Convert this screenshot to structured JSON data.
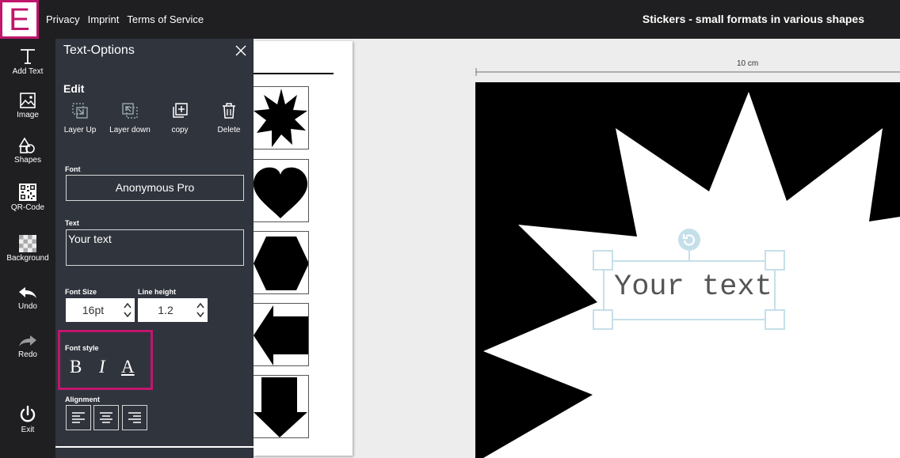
{
  "header": {
    "logo_letter": "E",
    "links": [
      "Privacy",
      "Imprint",
      "Terms of Service"
    ],
    "title": "Stickers - small formats in various shapes"
  },
  "toolbar": {
    "items": [
      {
        "label": "Add Text",
        "icon": "text-icon"
      },
      {
        "label": "Image",
        "icon": "image-icon"
      },
      {
        "label": "Shapes",
        "icon": "shapes-icon"
      },
      {
        "label": "QR-Code",
        "icon": "qr-code-icon"
      },
      {
        "label": "Background",
        "icon": "background-icon"
      },
      {
        "label": "Undo",
        "icon": "undo-icon"
      },
      {
        "label": "Redo",
        "icon": "redo-icon"
      },
      {
        "label": "Exit",
        "icon": "power-icon"
      }
    ]
  },
  "panel": {
    "title": "Text-Options",
    "edit_heading": "Edit",
    "edit_buttons": [
      {
        "label": "Layer Up",
        "icon": "layer-up-icon"
      },
      {
        "label": "Layer down",
        "icon": "layer-down-icon"
      },
      {
        "label": "copy",
        "icon": "copy-icon"
      },
      {
        "label": "Delete",
        "icon": "trash-icon"
      }
    ],
    "font_label": "Font",
    "font_value": "Anonymous Pro",
    "text_label": "Text",
    "text_value": "Your text",
    "font_size_label": "Font Size",
    "font_size_value": "16pt",
    "line_height_label": "Line height",
    "line_height_value": "1.2",
    "font_style_label": "Font style",
    "font_style_buttons": {
      "bold": "B",
      "italic": "I",
      "underline": "A"
    },
    "alignment_label": "Alignment",
    "highlight_color": "#c0166d"
  },
  "templates": {
    "shapes": [
      "starburst",
      "heart",
      "hexagon",
      "arrow-left",
      "arrow-down"
    ]
  },
  "canvas": {
    "ruler_label": "10 cm",
    "text_content": "Your text",
    "selection_color": "#c5dfe9"
  },
  "colors": {
    "brand": "#c0166d",
    "topbar_bg": "#1f1f21",
    "panel_bg": "#30343d"
  }
}
